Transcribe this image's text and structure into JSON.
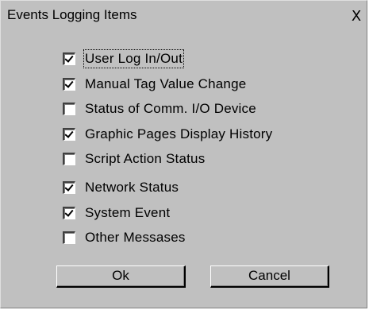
{
  "window": {
    "title": "Events Logging Items",
    "close_glyph": "X"
  },
  "options": [
    {
      "label": "User Log In/Out",
      "checked": true
    },
    {
      "label": "Manual Tag Value Change",
      "checked": true
    },
    {
      "label": "Status of Comm. I/O Device",
      "checked": false
    },
    {
      "label": "Graphic Pages Display History",
      "checked": true
    },
    {
      "label": "Script Action Status",
      "checked": false
    },
    {
      "label": "Network Status",
      "checked": true
    },
    {
      "label": "System Event",
      "checked": true
    },
    {
      "label": "Other Messases",
      "checked": false
    }
  ],
  "buttons": {
    "ok_label": "Ok",
    "cancel_label": "Cancel"
  }
}
